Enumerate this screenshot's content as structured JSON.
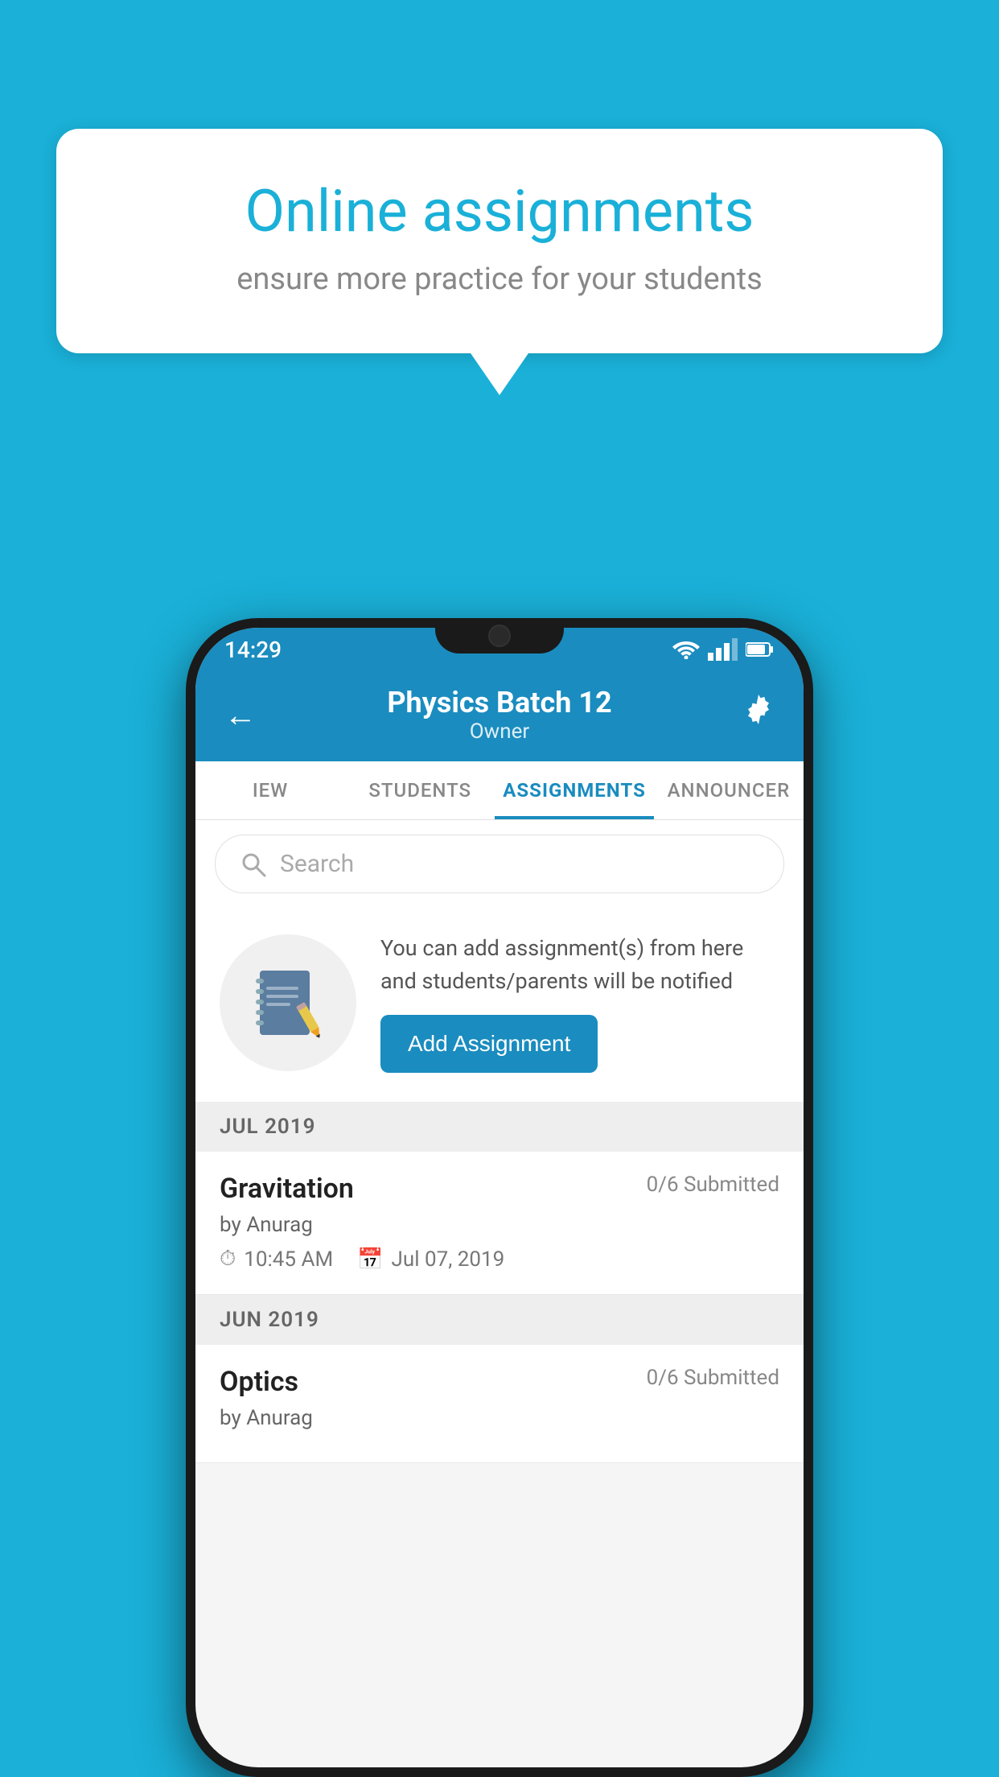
{
  "background": {
    "color": "#1ab0d8"
  },
  "speech_bubble": {
    "title": "Online assignments",
    "subtitle": "ensure more practice for your students"
  },
  "status_bar": {
    "time": "14:29"
  },
  "header": {
    "title": "Physics Batch 12",
    "subtitle": "Owner"
  },
  "tabs": [
    {
      "label": "IEW",
      "active": false
    },
    {
      "label": "STUDENTS",
      "active": false
    },
    {
      "label": "ASSIGNMENTS",
      "active": true
    },
    {
      "label": "ANNOUNCER",
      "active": false
    }
  ],
  "search": {
    "placeholder": "Search"
  },
  "promo": {
    "description": "You can add assignment(s) from here and students/parents will be notified",
    "button_label": "Add Assignment"
  },
  "sections": [
    {
      "month": "JUL 2019",
      "assignments": [
        {
          "name": "Gravitation",
          "submitted": "0/6 Submitted",
          "by": "by Anurag",
          "time": "10:45 AM",
          "date": "Jul 07, 2019"
        }
      ]
    },
    {
      "month": "JUN 2019",
      "assignments": [
        {
          "name": "Optics",
          "submitted": "0/6 Submitted",
          "by": "by Anurag",
          "time": "",
          "date": ""
        }
      ]
    }
  ]
}
